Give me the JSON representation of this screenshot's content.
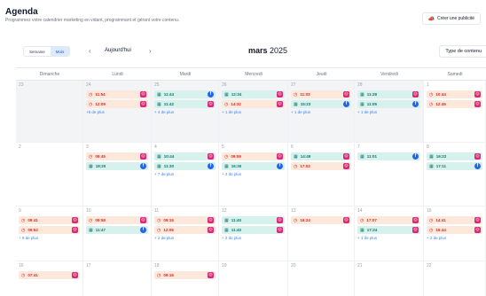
{
  "header": {
    "title": "Agenda",
    "subtitle": "Programmez votre calendrier marketing en vidant, programmant et gérant votre contenu.",
    "create_label": "Créer une publicité"
  },
  "toolbar": {
    "view_week": "Semaine",
    "view_month": "Mois",
    "prev": "‹",
    "today": "Aujourd'hui",
    "next": "›",
    "month_name": "mars",
    "year": "2025",
    "type_label": "Type de contenu"
  },
  "weekdays": [
    "Dimanche",
    "Lundi",
    "Mardi",
    "Mercredi",
    "Jeudi",
    "Vendredi",
    "Samedi"
  ],
  "weeks": [
    {
      "days": [
        {
          "num": "23",
          "shade": true,
          "events": [],
          "more": ""
        },
        {
          "num": "24",
          "shade": true,
          "events": [
            {
              "kind": "orange",
              "time": "11:54",
              "platform": "ig"
            },
            {
              "kind": "orange",
              "time": "12:09",
              "platform": "ig"
            }
          ],
          "more": "+5 de plus"
        },
        {
          "num": "25",
          "shade": true,
          "events": [
            {
              "kind": "green",
              "time": "11:44",
              "platform": "fb"
            },
            {
              "kind": "green",
              "time": "11:42",
              "platform": "ig"
            }
          ],
          "more": "+ 4 de plus"
        },
        {
          "num": "26",
          "shade": true,
          "events": [
            {
              "kind": "green",
              "time": "12:34",
              "platform": "ig"
            },
            {
              "kind": "orange",
              "time": "14:32",
              "platform": "ig"
            }
          ],
          "more": "+ 1 de plus"
        },
        {
          "num": "27",
          "shade": true,
          "events": [
            {
              "kind": "orange",
              "time": "11:03",
              "platform": "ig"
            },
            {
              "kind": "green",
              "time": "15:23",
              "platform": "fb"
            }
          ],
          "more": "+ 1 de plus"
        },
        {
          "num": "28",
          "shade": true,
          "events": [
            {
              "kind": "green",
              "time": "11:28",
              "platform": "ig"
            },
            {
              "kind": "green",
              "time": "11:05",
              "platform": "fb"
            }
          ],
          "more": "+ 1 de plus"
        },
        {
          "num": "1",
          "shade": false,
          "events": [
            {
              "kind": "orange",
              "time": "10:44",
              "platform": "ig"
            },
            {
              "kind": "orange",
              "time": "12:46",
              "platform": "ig"
            }
          ],
          "more": ""
        }
      ]
    },
    {
      "days": [
        {
          "num": "2",
          "shade": false,
          "events": [],
          "more": ""
        },
        {
          "num": "3",
          "shade": false,
          "events": [
            {
              "kind": "orange",
              "time": "09:45",
              "platform": "ig"
            },
            {
              "kind": "green",
              "time": "18:20",
              "platform": "fb"
            }
          ],
          "more": ""
        },
        {
          "num": "4",
          "shade": false,
          "events": [
            {
              "kind": "green",
              "time": "10:44",
              "platform": "ig"
            },
            {
              "kind": "green",
              "time": "11:30",
              "platform": "fb"
            }
          ],
          "more": "+ 7 de plus"
        },
        {
          "num": "5",
          "shade": false,
          "events": [
            {
              "kind": "orange",
              "time": "09:59",
              "platform": "ig"
            },
            {
              "kind": "green",
              "time": "16:30",
              "platform": "fb"
            }
          ],
          "more": "+ 4 de plus"
        },
        {
          "num": "6",
          "shade": false,
          "events": [
            {
              "kind": "green",
              "time": "14:49",
              "platform": "ig"
            },
            {
              "kind": "orange",
              "time": "17:02",
              "platform": "ig"
            }
          ],
          "more": ""
        },
        {
          "num": "7",
          "shade": false,
          "events": [
            {
              "kind": "green",
              "time": "11:01",
              "platform": "fb"
            }
          ],
          "more": ""
        },
        {
          "num": "8",
          "shade": false,
          "events": [
            {
              "kind": "green",
              "time": "16:22",
              "platform": "ig"
            },
            {
              "kind": "green",
              "time": "17:11",
              "platform": "fb"
            }
          ],
          "more": ""
        }
      ]
    },
    {
      "days": [
        {
          "num": "9",
          "shade": false,
          "events": [
            {
              "kind": "orange",
              "time": "09:41",
              "platform": "ig"
            },
            {
              "kind": "orange",
              "time": "09:52",
              "platform": "ig"
            }
          ],
          "more": "+ 6 de plus"
        },
        {
          "num": "10",
          "shade": false,
          "events": [
            {
              "kind": "orange",
              "time": "09:58",
              "platform": "ig"
            },
            {
              "kind": "green",
              "time": "11:47",
              "platform": "fb"
            }
          ],
          "more": ""
        },
        {
          "num": "11",
          "shade": false,
          "events": [
            {
              "kind": "orange",
              "time": "09:15",
              "platform": "ig"
            },
            {
              "kind": "orange",
              "time": "12:06",
              "platform": "ig"
            }
          ],
          "more": "+ 2 de plus"
        },
        {
          "num": "12",
          "shade": false,
          "events": [
            {
              "kind": "green",
              "time": "11:40",
              "platform": "ig"
            },
            {
              "kind": "green",
              "time": "11:40",
              "platform": "ig"
            }
          ],
          "more": "+ 2 de plus"
        },
        {
          "num": "13",
          "shade": false,
          "events": [
            {
              "kind": "orange",
              "time": "16:24",
              "platform": "ig"
            }
          ],
          "more": ""
        },
        {
          "num": "14",
          "shade": false,
          "events": [
            {
              "kind": "orange",
              "time": "17:07",
              "platform": "ig"
            },
            {
              "kind": "green",
              "time": "17:24",
              "platform": "ig"
            }
          ],
          "more": "+ 1 de plus"
        },
        {
          "num": "15",
          "shade": false,
          "events": [
            {
              "kind": "orange",
              "time": "14:41",
              "platform": "ig"
            },
            {
              "kind": "orange",
              "time": "16:44",
              "platform": "ig"
            }
          ],
          "more": "+ 2 de plus"
        }
      ]
    },
    {
      "days": [
        {
          "num": "16",
          "shade": false,
          "events": [
            {
              "kind": "orange",
              "time": "07:41",
              "platform": "ig"
            }
          ],
          "more": ""
        },
        {
          "num": "17",
          "shade": false,
          "events": [],
          "more": ""
        },
        {
          "num": "18",
          "shade": false,
          "events": [
            {
              "kind": "orange",
              "time": "09:16",
              "platform": "ig"
            }
          ],
          "more": ""
        },
        {
          "num": "19",
          "shade": false,
          "events": [],
          "more": ""
        },
        {
          "num": "20",
          "shade": false,
          "events": [],
          "more": ""
        },
        {
          "num": "21",
          "shade": false,
          "events": [],
          "more": ""
        },
        {
          "num": "22",
          "shade": false,
          "events": [],
          "more": ""
        }
      ]
    }
  ],
  "colors": {
    "orange_bg": "#fde9dc",
    "orange_text": "#dc2626",
    "green_bg": "#d7f1ec",
    "green_text": "#0f766e",
    "instagram": "#db2777",
    "facebook": "#2563eb",
    "link": "#3b82f6"
  }
}
